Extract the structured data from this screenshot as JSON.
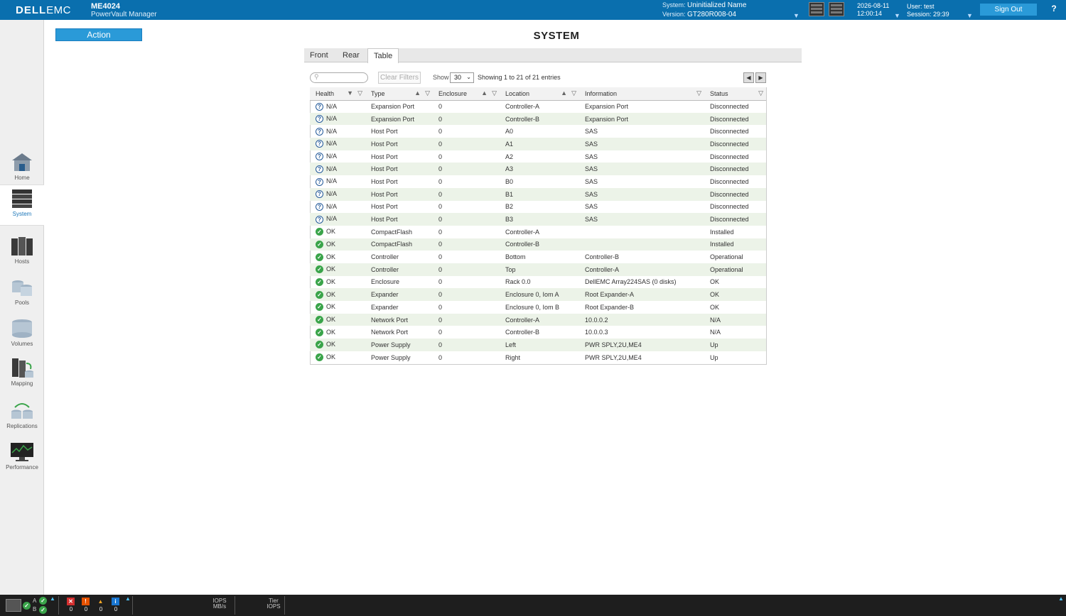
{
  "header": {
    "brand_bold": "DELL",
    "brand_rest": "EMC",
    "model": "ME4024",
    "product": "PowerVault Manager",
    "system_label": "System:",
    "system_name": "Uninitialized Name",
    "version_label": "Version:",
    "version": "GT280R008-04",
    "date": "2026-08-11",
    "time": "12:00:14",
    "user_label": "User:",
    "user": "test",
    "session_label": "Session:",
    "session": "29:39",
    "signout_label": "Sign Out",
    "help_label": "?"
  },
  "nav": [
    {
      "label": "Home",
      "icon": "home-icon"
    },
    {
      "label": "System",
      "icon": "system-icon"
    },
    {
      "label": "Hosts",
      "icon": "hosts-icon"
    },
    {
      "label": "Pools",
      "icon": "pools-icon"
    },
    {
      "label": "Volumes",
      "icon": "volumes-icon"
    },
    {
      "label": "Mapping",
      "icon": "mapping-icon"
    },
    {
      "label": "Replications",
      "icon": "replications-icon"
    },
    {
      "label": "Performance",
      "icon": "performance-icon"
    }
  ],
  "action_label": "Action",
  "page_title": "SYSTEM",
  "tabs": [
    {
      "label": "Front"
    },
    {
      "label": "Rear"
    },
    {
      "label": "Table"
    }
  ],
  "toolbar": {
    "clear_filters": "Clear Filters",
    "show_label": "Show",
    "show_value": "30",
    "entries_text": "Showing 1 to 21 of 21 entries"
  },
  "columns": [
    "Health",
    "Type",
    "Enclosure",
    "Location",
    "Information",
    "Status"
  ],
  "rows": [
    {
      "health": "N/A",
      "type": "Expansion Port",
      "enclosure": "0",
      "location": "Controller-A",
      "information": "Expansion Port",
      "status": "Disconnected"
    },
    {
      "health": "N/A",
      "type": "Expansion Port",
      "enclosure": "0",
      "location": "Controller-B",
      "information": "Expansion Port",
      "status": "Disconnected"
    },
    {
      "health": "N/A",
      "type": "Host Port",
      "enclosure": "0",
      "location": "A0",
      "information": "SAS",
      "status": "Disconnected"
    },
    {
      "health": "N/A",
      "type": "Host Port",
      "enclosure": "0",
      "location": "A1",
      "information": "SAS",
      "status": "Disconnected"
    },
    {
      "health": "N/A",
      "type": "Host Port",
      "enclosure": "0",
      "location": "A2",
      "information": "SAS",
      "status": "Disconnected"
    },
    {
      "health": "N/A",
      "type": "Host Port",
      "enclosure": "0",
      "location": "A3",
      "information": "SAS",
      "status": "Disconnected"
    },
    {
      "health": "N/A",
      "type": "Host Port",
      "enclosure": "0",
      "location": "B0",
      "information": "SAS",
      "status": "Disconnected"
    },
    {
      "health": "N/A",
      "type": "Host Port",
      "enclosure": "0",
      "location": "B1",
      "information": "SAS",
      "status": "Disconnected"
    },
    {
      "health": "N/A",
      "type": "Host Port",
      "enclosure": "0",
      "location": "B2",
      "information": "SAS",
      "status": "Disconnected"
    },
    {
      "health": "N/A",
      "type": "Host Port",
      "enclosure": "0",
      "location": "B3",
      "information": "SAS",
      "status": "Disconnected"
    },
    {
      "health": "OK",
      "type": "CompactFlash",
      "enclosure": "0",
      "location": "Controller-A",
      "information": "",
      "status": "Installed"
    },
    {
      "health": "OK",
      "type": "CompactFlash",
      "enclosure": "0",
      "location": "Controller-B",
      "information": "",
      "status": "Installed"
    },
    {
      "health": "OK",
      "type": "Controller",
      "enclosure": "0",
      "location": "Bottom",
      "information": "Controller-B",
      "status": "Operational"
    },
    {
      "health": "OK",
      "type": "Controller",
      "enclosure": "0",
      "location": "Top",
      "information": "Controller-A",
      "status": "Operational"
    },
    {
      "health": "OK",
      "type": "Enclosure",
      "enclosure": "0",
      "location": "Rack 0.0",
      "information": "DellEMC Array224SAS (0 disks)",
      "status": "OK"
    },
    {
      "health": "OK",
      "type": "Expander",
      "enclosure": "0",
      "location": "Enclosure 0, Iom A",
      "information": "Root Expander-A",
      "status": "OK"
    },
    {
      "health": "OK",
      "type": "Expander",
      "enclosure": "0",
      "location": "Enclosure 0, Iom B",
      "information": "Root Expander-B",
      "status": "OK"
    },
    {
      "health": "OK",
      "type": "Network Port",
      "enclosure": "0",
      "location": "Controller-A",
      "information": "10.0.0.2",
      "status": "N/A"
    },
    {
      "health": "OK",
      "type": "Network Port",
      "enclosure": "0",
      "location": "Controller-B",
      "information": "10.0.0.3",
      "status": "N/A"
    },
    {
      "health": "OK",
      "type": "Power Supply",
      "enclosure": "0",
      "location": "Left",
      "information": "PWR SPLY,2U,ME4",
      "status": "Up"
    },
    {
      "health": "OK",
      "type": "Power Supply",
      "enclosure": "0",
      "location": "Right",
      "information": "PWR SPLY,2U,ME4",
      "status": "Up"
    }
  ],
  "footer": {
    "controller_a": "A",
    "controller_b": "B",
    "critical_count": "0",
    "error_count": "0",
    "warning_count": "0",
    "info_count": "0",
    "iops_label": "IOPS",
    "mbs_label": "MB/s",
    "tier_label": "Tier",
    "tier_iops_label": "IOPS"
  },
  "colors": {
    "header_bg": "#0a6fae",
    "accent": "#2a9ad8",
    "ok_green": "#3aa44a",
    "footer_bg": "#1e1e1e"
  }
}
